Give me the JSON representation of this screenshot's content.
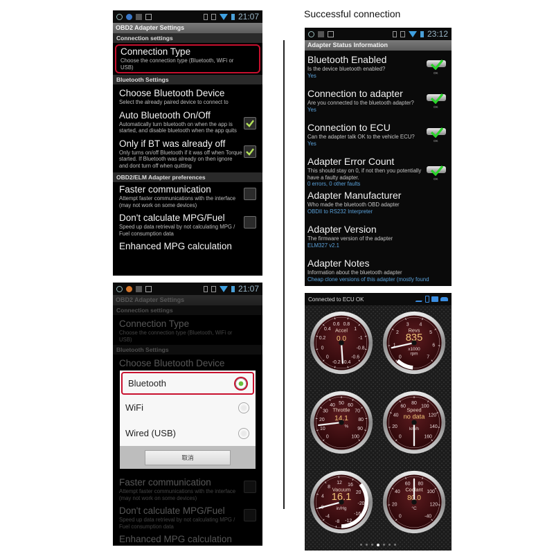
{
  "caption": "Successful connection",
  "panel1": {
    "status_time": "21:07",
    "title": "OBD2 Adapter Settings",
    "sections": {
      "connection": "Connection settings",
      "bluetooth": "Bluetooth Settings",
      "obd": "OBD2/ELM Adapter preferences"
    },
    "items": [
      {
        "title": "Connection Type",
        "summary": "Choose the connection type (Bluetooth, WiFi or USB)",
        "highlighted": true
      },
      {
        "title": "Choose Bluetooth Device",
        "summary": "Select the already paired device to connect to"
      },
      {
        "title": "Auto Bluetooth On/Off",
        "summary": "Automatically turn bluetooth on when the app is started, and disable bluetooth when the app quits",
        "checked": true
      },
      {
        "title": "Only if BT was already off",
        "summary": "Only turns on/off Bluetooth if it was off when Torque started. If Bluetooth was already on then ignore and dont turn off when quitting",
        "checked": true
      },
      {
        "title": "Faster communication",
        "summary": "Attempt faster communications with the interface (may not work on some devices)",
        "checked": false
      },
      {
        "title": "Don't calculate MPG/Fuel",
        "summary": "Speed up data retrieval by not calculating MPG / Fuel consumption data",
        "checked": false
      },
      {
        "title": "Enhanced MPG calculation"
      }
    ]
  },
  "panel2": {
    "status_time": "21:07",
    "title": "OBD2 Adapter Settings",
    "dialog": {
      "options": [
        {
          "label": "Bluetooth",
          "selected": true
        },
        {
          "label": "WiFi",
          "selected": false
        },
        {
          "label": "Wired (USB)",
          "selected": false
        }
      ],
      "cancel_label": "取消"
    }
  },
  "panel3": {
    "status_time": "23:12",
    "title": "Adapter Status Information",
    "items": [
      {
        "title": "Bluetooth Enabled",
        "summary": "Is the device bluetooth enabled?",
        "value": "Yes",
        "ok": true
      },
      {
        "title": "Connection to adapter",
        "summary": "Are you connected to the bluetooth adapter?",
        "value": "Yes",
        "ok": true
      },
      {
        "title": "Connection to ECU",
        "summary": "Can the adapter talk OK to the vehicle ECU?",
        "value": "Yes",
        "ok": true
      },
      {
        "title": "Adapter Error Count",
        "summary": "This should stay on 0, if not then you potentially have a faulty adapter.",
        "value": "0 errors, 0 other faults",
        "ok": true
      },
      {
        "title": "Adapter Manufacturer",
        "summary": "Who made the bluetooth OBD adapter",
        "value": "OBDII to RS232 Interpreter"
      },
      {
        "title": "Adapter Version",
        "summary": "The firmware version of the adapter",
        "value": "ELM327 v2.1"
      },
      {
        "title": "Adapter Notes",
        "summary": "Information about the bluetooth adapter",
        "value": "Cheap clone versions of this adapter (mostly found"
      }
    ],
    "ok_label": "OK"
  },
  "panel4": {
    "status": "Connected to ECU OK",
    "page_index": 3,
    "page_count": 7,
    "gauges": [
      {
        "name": "Accel",
        "value": "0.0",
        "unit": "",
        "ticks": [
          "0",
          "0.2",
          "0.4",
          "0.6",
          "0.8",
          "1",
          "-1",
          "-0.8",
          "-0.6",
          "-0.4",
          "-0.2",
          "0"
        ],
        "needle_fraction": 0.0
      },
      {
        "name": "Revs",
        "value": "835",
        "unit": "x1000 rpm",
        "ticks": [
          "0",
          "1",
          "2",
          "3",
          "4",
          "5",
          "6",
          "7"
        ],
        "needle_fraction": 0.12
      },
      {
        "name": "Throttle",
        "value": "14.1",
        "unit": "%",
        "ticks": [
          "0",
          "10",
          "20",
          "30",
          "40",
          "50",
          "60",
          "70",
          "80",
          "90",
          "100"
        ],
        "needle_fraction": 0.141
      },
      {
        "name": "Speed",
        "value": "no data",
        "unit": "km/h",
        "ticks": [
          "0",
          "20",
          "40",
          "60",
          "80",
          "100",
          "120",
          "140",
          "160"
        ],
        "needle_fraction": 0.0
      },
      {
        "name": "Vacuum",
        "value": "16.1",
        "unit": "in/Hg",
        "ticks": [
          "0",
          "4",
          "8",
          "12",
          "16",
          "20",
          "-20",
          "-16",
          "-12",
          "-8",
          "-4"
        ],
        "needle_fraction": 0.0
      },
      {
        "name": "Coolant",
        "value": "80.0",
        "unit": "°C",
        "ticks": [
          "0",
          "20",
          "40",
          "60",
          "80",
          "100",
          "120",
          "-40"
        ],
        "needle_fraction": 0.5
      }
    ]
  }
}
